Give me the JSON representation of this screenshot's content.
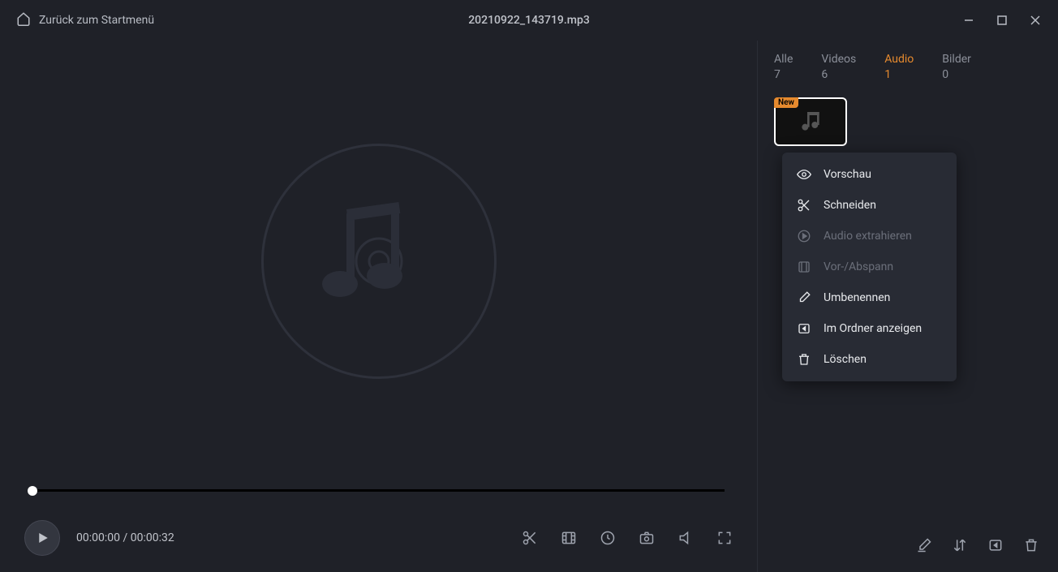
{
  "titlebar": {
    "back_label": "Zurück zum Startmenü",
    "file_title": "20210922_143719.mp3"
  },
  "player": {
    "time_current": "00:00:00",
    "time_separator": " / ",
    "time_total": "00:00:32"
  },
  "tabs": [
    {
      "label": "Alle",
      "count": "7",
      "active": false
    },
    {
      "label": "Videos",
      "count": "6",
      "active": false
    },
    {
      "label": "Audio",
      "count": "1",
      "active": true
    },
    {
      "label": "Bilder",
      "count": "0",
      "active": false
    }
  ],
  "thumbnail": {
    "badge": "New"
  },
  "context_menu": [
    {
      "label": "Vorschau",
      "enabled": true
    },
    {
      "label": "Schneiden",
      "enabled": true
    },
    {
      "label": "Audio extrahieren",
      "enabled": false
    },
    {
      "label": "Vor-/Abspann",
      "enabled": false
    },
    {
      "label": "Umbenennen",
      "enabled": true
    },
    {
      "label": "Im Ordner anzeigen",
      "enabled": true
    },
    {
      "label": "Löschen",
      "enabled": true
    }
  ]
}
